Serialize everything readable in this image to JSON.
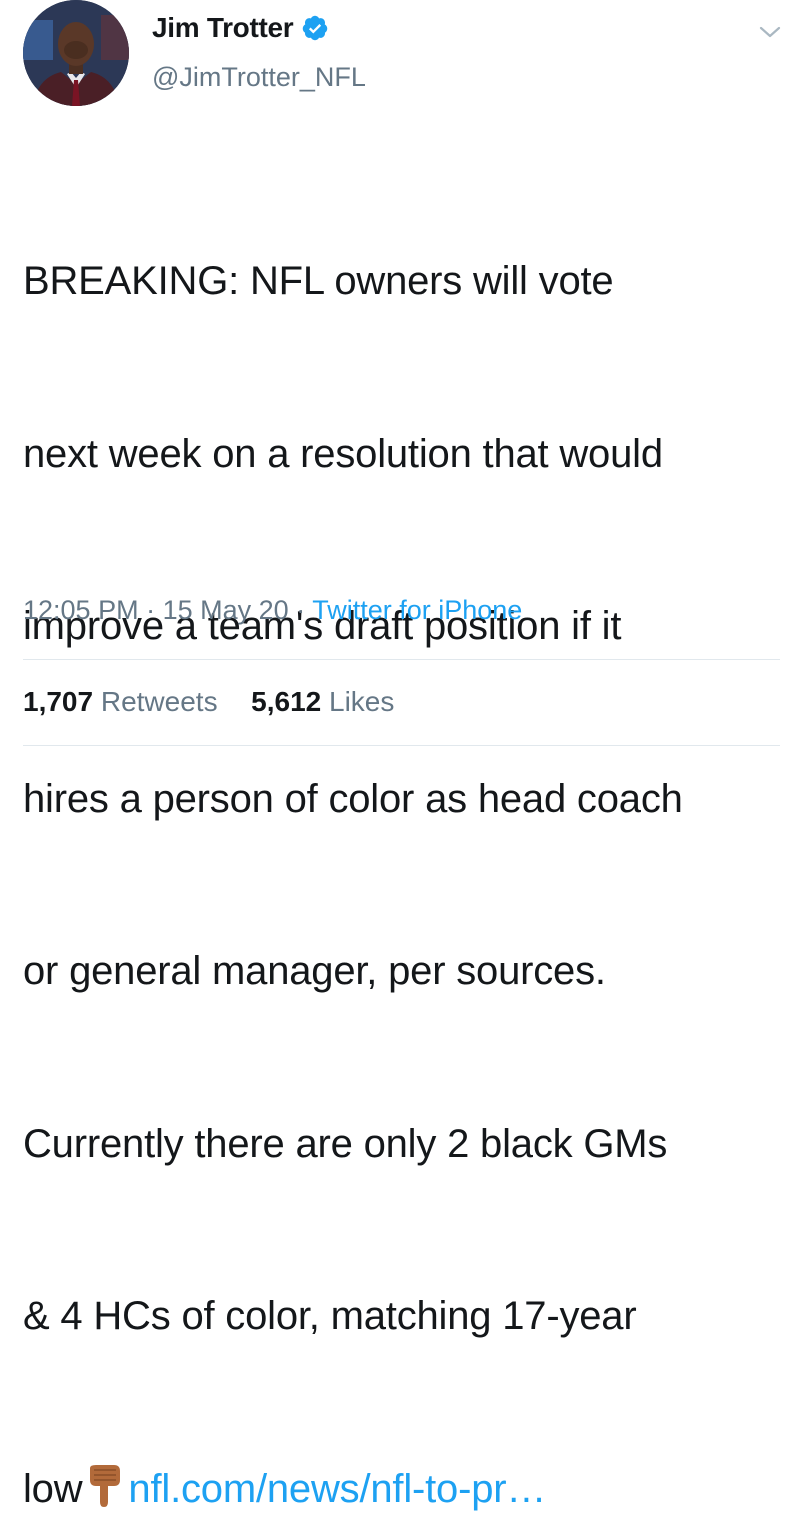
{
  "author": {
    "display_name": "Jim Trotter",
    "handle": "@JimTrotter_NFL",
    "verified": true,
    "avatar_icon": "profile-photo"
  },
  "tweet": {
    "lines": [
      "BREAKING: NFL owners will vote",
      "next week on a resolution that would",
      "improve a team's draft position if it",
      "hires a person of color as head coach",
      "or general manager, per sources.",
      "Currently there are only 2 black GMs",
      "& 4 HCs of color, matching 17-year"
    ],
    "last_line_text": "low",
    "emoji_icon": "backhand-index-pointing-down-icon",
    "link_text": "nfl.com/news/nfl-to-pr…"
  },
  "meta": {
    "time": "12:05 PM",
    "date": "15 May 20",
    "separator": "·",
    "source": "Twitter for iPhone"
  },
  "stats": {
    "retweets_count": "1,707",
    "retweets_label": "Retweets",
    "likes_count": "5,612",
    "likes_label": "Likes"
  },
  "colors": {
    "link": "#1da1f2",
    "secondary_text": "#657786",
    "primary_text": "#14171a",
    "divider": "#e1e8ed"
  }
}
